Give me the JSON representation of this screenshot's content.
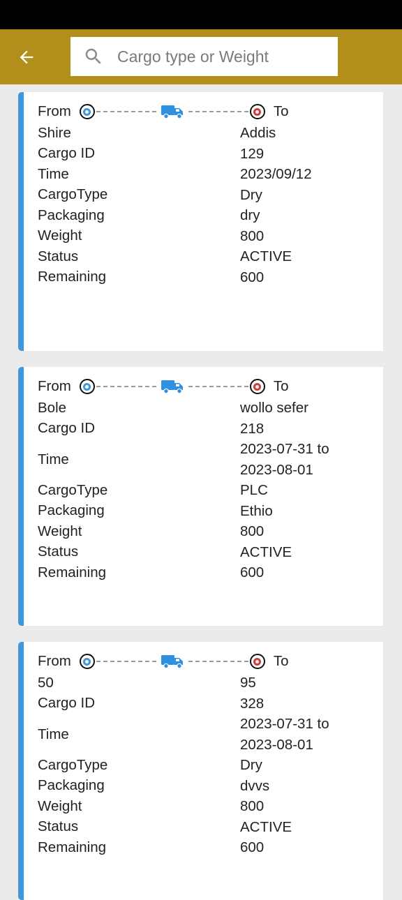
{
  "search": {
    "placeholder": "Cargo type or Weight",
    "value": ""
  },
  "labels": {
    "from": "From",
    "to": "To",
    "cargo_id": "Cargo ID",
    "time": "Time",
    "cargo_type": "CargoType",
    "packaging": "Packaging",
    "weight": "Weight",
    "status": "Status",
    "remaining": "Remaining"
  },
  "colors": {
    "app_bar": "#b28e1a",
    "accent": "#3f97dc",
    "destination": "#d13b3b"
  },
  "cargos": [
    {
      "origin": "Shire",
      "destination": "Addis",
      "cargo_id": "129",
      "time": "2023/09/12",
      "cargo_type": "Dry",
      "packaging": "dry",
      "weight": "800",
      "status": "ACTIVE",
      "remaining": "600"
    },
    {
      "origin": "Bole",
      "destination": "wollo sefer",
      "cargo_id": "218",
      "time": "2023-07-31 to 2023-08-01",
      "cargo_type": "PLC",
      "packaging": "Ethio",
      "weight": "800",
      "status": "ACTIVE",
      "remaining": "600"
    },
    {
      "origin": "50",
      "destination": "95",
      "cargo_id": "328",
      "time": "2023-07-31 to 2023-08-01",
      "cargo_type": "Dry",
      "packaging": "dvvs",
      "weight": "800",
      "status": "ACTIVE",
      "remaining": "600"
    }
  ]
}
